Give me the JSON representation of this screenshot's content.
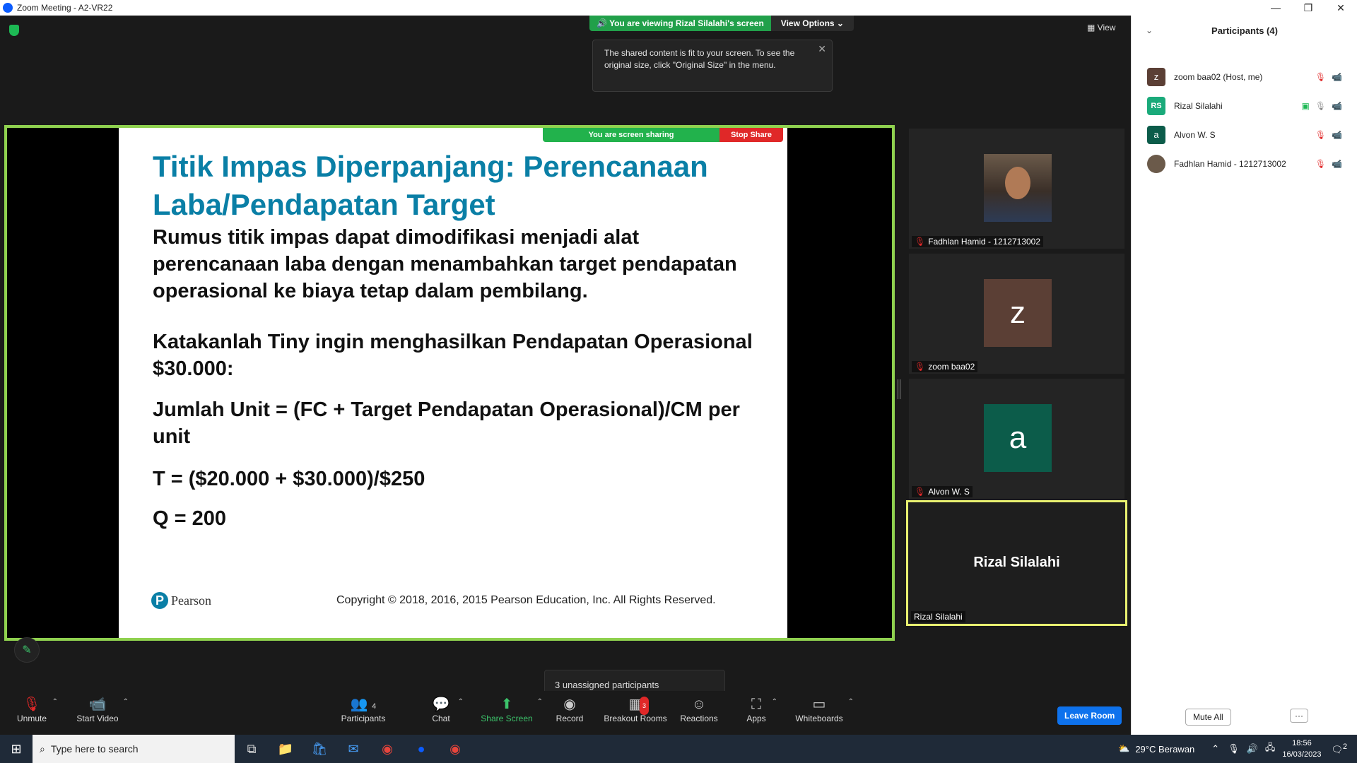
{
  "window": {
    "title": "Zoom Meeting - A2-VR22",
    "min": "—",
    "max": "❐",
    "close": "✕"
  },
  "banner": {
    "viewing": "You are viewing Rizal Silalahi's screen",
    "view_options": "View Options"
  },
  "tooltip": {
    "text": "The shared content is fit to your screen. To see the original size, click \"Original Size\" in the menu.",
    "close": "✕"
  },
  "view_button": "View",
  "share_bar": {
    "sharing": "You are screen sharing",
    "stop": "Stop Share"
  },
  "slide": {
    "title": "Titik Impas Diperpanjang: Perencanaan Laba/Pendapatan Target",
    "para1": "Rumus titik impas dapat dimodifikasi menjadi alat perencanaan laba dengan menambahkan target pendapatan operasional ke biaya tetap dalam pembilang.",
    "para2": "Katakanlah Tiny ingin menghasilkan Pendapatan Operasional $30.000:",
    "para3": "Jumlah Unit = (FC + Target Pendapatan Operasional)/CM per unit",
    "para4": "T = ($20.000 + $30.000)/$250",
    "para5": "Q = 200",
    "brand": "Pearson",
    "copyright": "Copyright © 2018, 2016, 2015 Pearson Education, Inc. All Rights Reserved."
  },
  "tiles": [
    {
      "name": "Fadhlan Hamid - 1212713002",
      "muted": true
    },
    {
      "name": "zoom baa02",
      "initial": "z",
      "color": "#5b3f35",
      "muted": true
    },
    {
      "name": "Alvon W. S",
      "initial": "a",
      "color": "#0c5c4a",
      "muted": true
    },
    {
      "name": "Rizal Silalahi",
      "label": "Rizal Silalahi",
      "active": true
    }
  ],
  "unassigned": "3 unassigned participants",
  "toolbar": {
    "unmute": "Unmute",
    "start_video": "Start Video",
    "participants": "Participants",
    "participants_count": "4",
    "chat": "Chat",
    "share_screen": "Share Screen",
    "record": "Record",
    "breakout": "Breakout Rooms",
    "breakout_badge": "3",
    "reactions": "Reactions",
    "apps": "Apps",
    "whiteboards": "Whiteboards",
    "leave": "Leave Room"
  },
  "panel": {
    "title": "Participants (4)",
    "participants": [
      {
        "initial": "z",
        "name": "zoom baa02 (Host, me)",
        "color": "#5b3f35"
      },
      {
        "initial": "RS",
        "name": "Rizal Silalahi",
        "color": "#1aaa7a"
      },
      {
        "initial": "a",
        "name": "Alvon W. S",
        "color": "#0c5c4a"
      },
      {
        "initial": "",
        "name": "Fadhlan Hamid - 1212713002",
        "color": "#6b5a4a"
      }
    ],
    "mute_all": "Mute All",
    "more": "···"
  },
  "taskbar": {
    "search": "Type here to search",
    "weather": "29°C  Berawan",
    "time": "18:56",
    "date": "16/03/2023",
    "notif": "2"
  }
}
